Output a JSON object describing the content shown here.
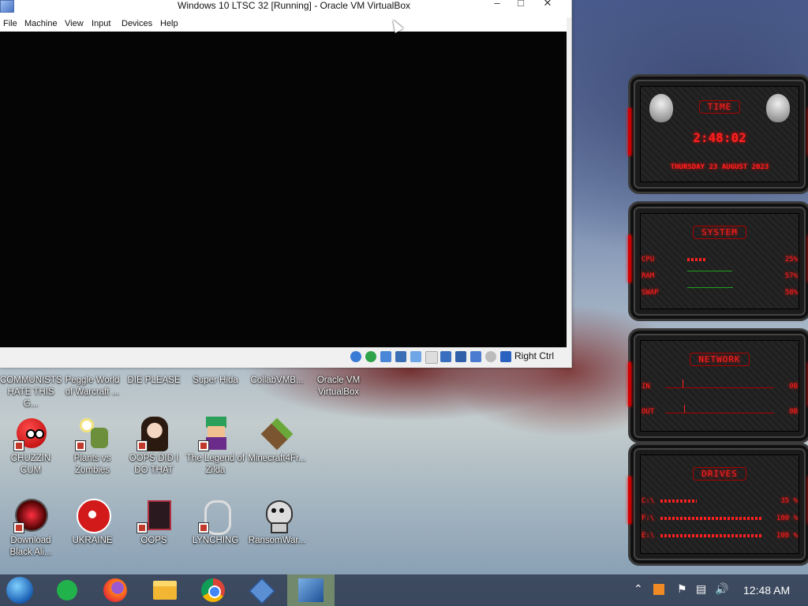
{
  "vm_window": {
    "title": "Windows 10 LTSC 32 [Running] - Oracle VM VirtualBox",
    "menu": [
      "File",
      "Machine",
      "View",
      "Input",
      "Devices",
      "Help"
    ],
    "host_key": "Right Ctrl"
  },
  "desktop": {
    "row1": [
      "COMMUNISTS HATE THIS G...",
      "Peggle World of Warcraft ...",
      "DIE PLEASE",
      "Super Hida",
      "CollabVMB...",
      "Oracle VM VirtualBox"
    ],
    "row2": [
      "CHUZZIN CUM",
      "Plants vs Zombies",
      "OOPS DID I DO THAT",
      "The Legend of Zilda",
      "Minecraft4Fr..."
    ],
    "row3": [
      "Download Black Ali...",
      "UKRAINE",
      "OOPS",
      "LYNCHING",
      "RansomWar..."
    ]
  },
  "widgets": {
    "time": {
      "title": "TIME",
      "clock": "2:48:02",
      "date": "THURSDAY 23 AUGUST 2023"
    },
    "system": {
      "title": "SYSTEM",
      "rows": [
        {
          "label": "CPU",
          "value": "25%"
        },
        {
          "label": "RAM",
          "value": "57%"
        },
        {
          "label": "SWAP",
          "value": "58%"
        }
      ],
      "cpu_fill": 0.25,
      "ram_fill": 0.57,
      "swap_fill": 0.58
    },
    "network": {
      "title": "NETWORK",
      "rows": [
        {
          "label": "IN",
          "value": "0B"
        },
        {
          "label": "OUT",
          "value": "0B"
        }
      ]
    },
    "drives": {
      "title": "DRIVES",
      "rows": [
        {
          "label": "C:\\",
          "value": "35 %",
          "fill": 0.35
        },
        {
          "label": "F:\\",
          "value": "100 %",
          "fill": 1.0
        },
        {
          "label": "E:\\",
          "value": "100 %",
          "fill": 1.0
        }
      ]
    }
  },
  "taskbar": {
    "clock": "12:48 AM"
  },
  "colors": {
    "accent": "#ff2020",
    "taskbar": "#283246"
  }
}
